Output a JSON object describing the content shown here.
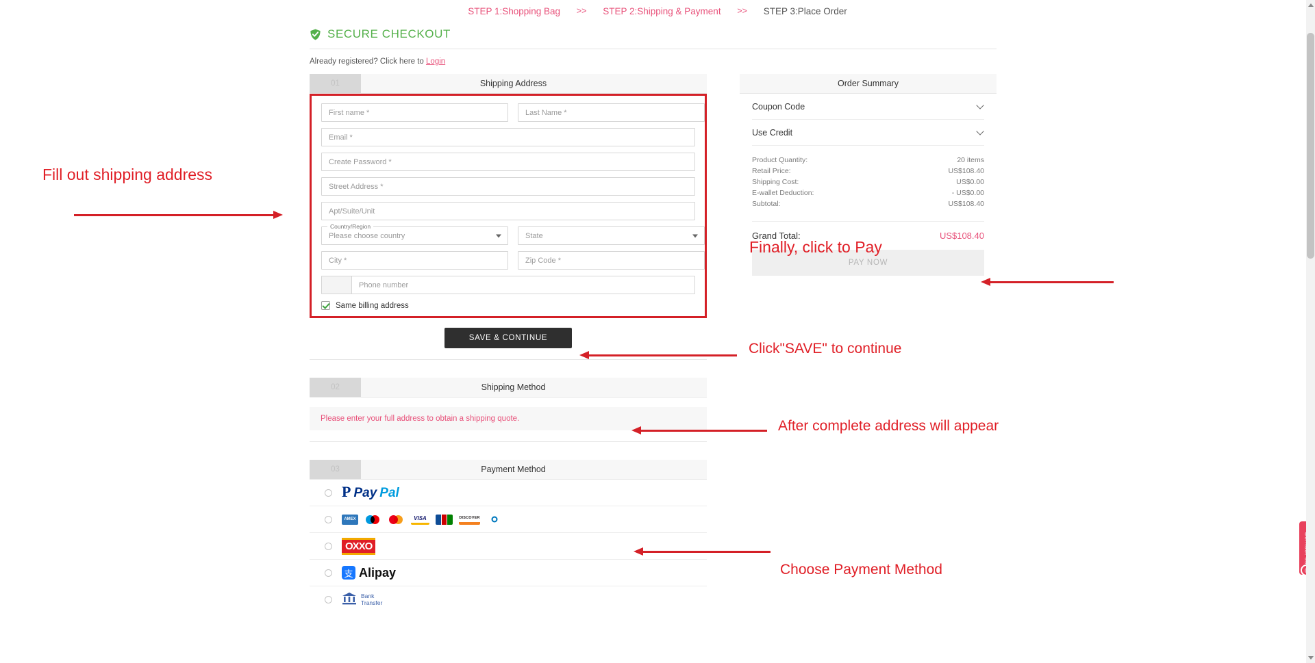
{
  "steps": {
    "step1": "STEP 1:Shopping Bag",
    "sep1": ">>",
    "step2": "STEP 2:Shipping & Payment",
    "sep2": ">>",
    "step3": "STEP 3:Place Order"
  },
  "secure": {
    "title": "SECURE CHECKOUT",
    "icon": "shield-check-icon",
    "color": "#54b04a"
  },
  "registered": {
    "text": "Already registered? Click here to ",
    "link": "Login"
  },
  "shipping_address": {
    "number": "01",
    "title": "Shipping Address",
    "fields": {
      "first_name": "First name *",
      "last_name": "Last Name *",
      "email": "Email *",
      "password": "Create Password *",
      "street": "Street Address *",
      "apt": "Apt/Suite/Unit",
      "country_legend": "Country/Region",
      "country": "Please choose country",
      "state": "State",
      "city": "City *",
      "zip": "Zip Code *",
      "phone": "Phone number"
    },
    "billing_checkbox": "Same billing address",
    "billing_checked": true,
    "save_button": "SAVE & CONTINUE"
  },
  "shipping_method": {
    "number": "02",
    "title": "Shipping Method",
    "notice": "Please enter your full address to obtain a shipping quote."
  },
  "payment_method": {
    "number": "03",
    "title": "Payment Method",
    "options": [
      {
        "id": "paypal",
        "mark": "P",
        "text1": "Pay",
        "text2": "Pal"
      },
      {
        "id": "credit-cards",
        "cards": [
          "AMEX",
          "Maestro",
          "VISA",
          "JCB",
          "DISCOVER",
          "Diners Club"
        ]
      },
      {
        "id": "oxxo",
        "label": "OXXO"
      },
      {
        "id": "alipay",
        "mark": "支",
        "label": "Alipay"
      },
      {
        "id": "bank-transfer",
        "line1": "Bank",
        "line2": "Transfer"
      }
    ]
  },
  "order_summary": {
    "title": "Order Summary",
    "coupon_code": "Coupon Code",
    "use_credit": "Use Credit",
    "lines": [
      {
        "label": "Product Quantity:",
        "value": "20 items"
      },
      {
        "label": "Retail Price:",
        "value": "US$108.40"
      },
      {
        "label": "Shipping Cost:",
        "value": "US$0.00"
      },
      {
        "label": "E-wallet Deduction:",
        "value": "- US$0.00"
      },
      {
        "label": "Subtotal:",
        "value": "US$108.40"
      }
    ],
    "grand_total_label": "Grand Total:",
    "grand_total_value": "US$108.40",
    "pay_button": "PAY NOW"
  },
  "annotations": {
    "fill_address": "Fill out shipping address",
    "click_save": "Click\"SAVE\" to continue",
    "address_appear": "After complete address will appear",
    "choose_payment": "Choose Payment Method",
    "click_pay": "Finally, click to Pay",
    "color": "#e01e26"
  },
  "contact_widget": {
    "label": "Contact us",
    "badge": "0"
  }
}
